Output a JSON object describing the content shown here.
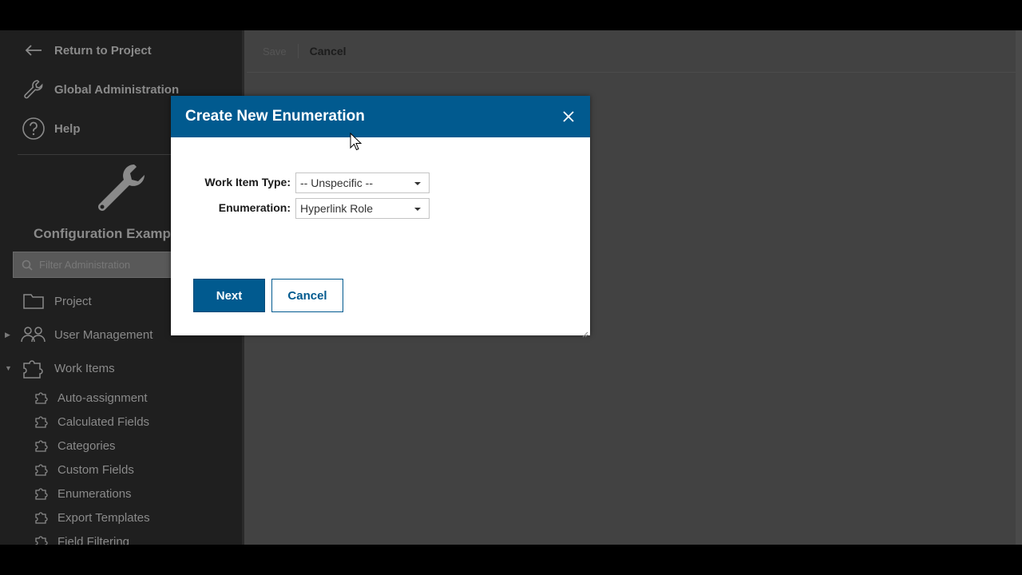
{
  "sidebar": {
    "top_items": [
      {
        "label": "Return to Project",
        "icon": "arrow-left-icon"
      },
      {
        "label": "Global Administration",
        "icon": "wrench-icon"
      },
      {
        "label": "Help",
        "icon": "question-circle-icon"
      }
    ],
    "project_name": "Configuration Example",
    "filter_placeholder": "Filter Administration",
    "tree": [
      {
        "label": "Project",
        "icon": "folder-icon",
        "expandable": false
      },
      {
        "label": "User Management",
        "icon": "users-icon",
        "expandable": true,
        "expanded": false
      },
      {
        "label": "Work Items",
        "icon": "puzzle-icon",
        "expandable": true,
        "expanded": true
      }
    ],
    "work_items_children": [
      {
        "label": "Auto-assignment"
      },
      {
        "label": "Calculated Fields"
      },
      {
        "label": "Categories"
      },
      {
        "label": "Custom Fields"
      },
      {
        "label": "Enumerations"
      },
      {
        "label": "Export Templates"
      },
      {
        "label": "Field Filtering"
      }
    ]
  },
  "toolbar": {
    "save_label": "Save",
    "cancel_label": "Cancel"
  },
  "dialog": {
    "title": "Create New Enumeration",
    "fields": [
      {
        "label": "Work Item Type:",
        "value": "-- Unspecific --"
      },
      {
        "label": "Enumeration:",
        "value": "Hyperlink Role"
      }
    ],
    "next_label": "Next",
    "cancel_label": "Cancel"
  },
  "colors": {
    "accent": "#015a8f",
    "overlay": "#424242",
    "sidebar": "#1f1f1f"
  }
}
